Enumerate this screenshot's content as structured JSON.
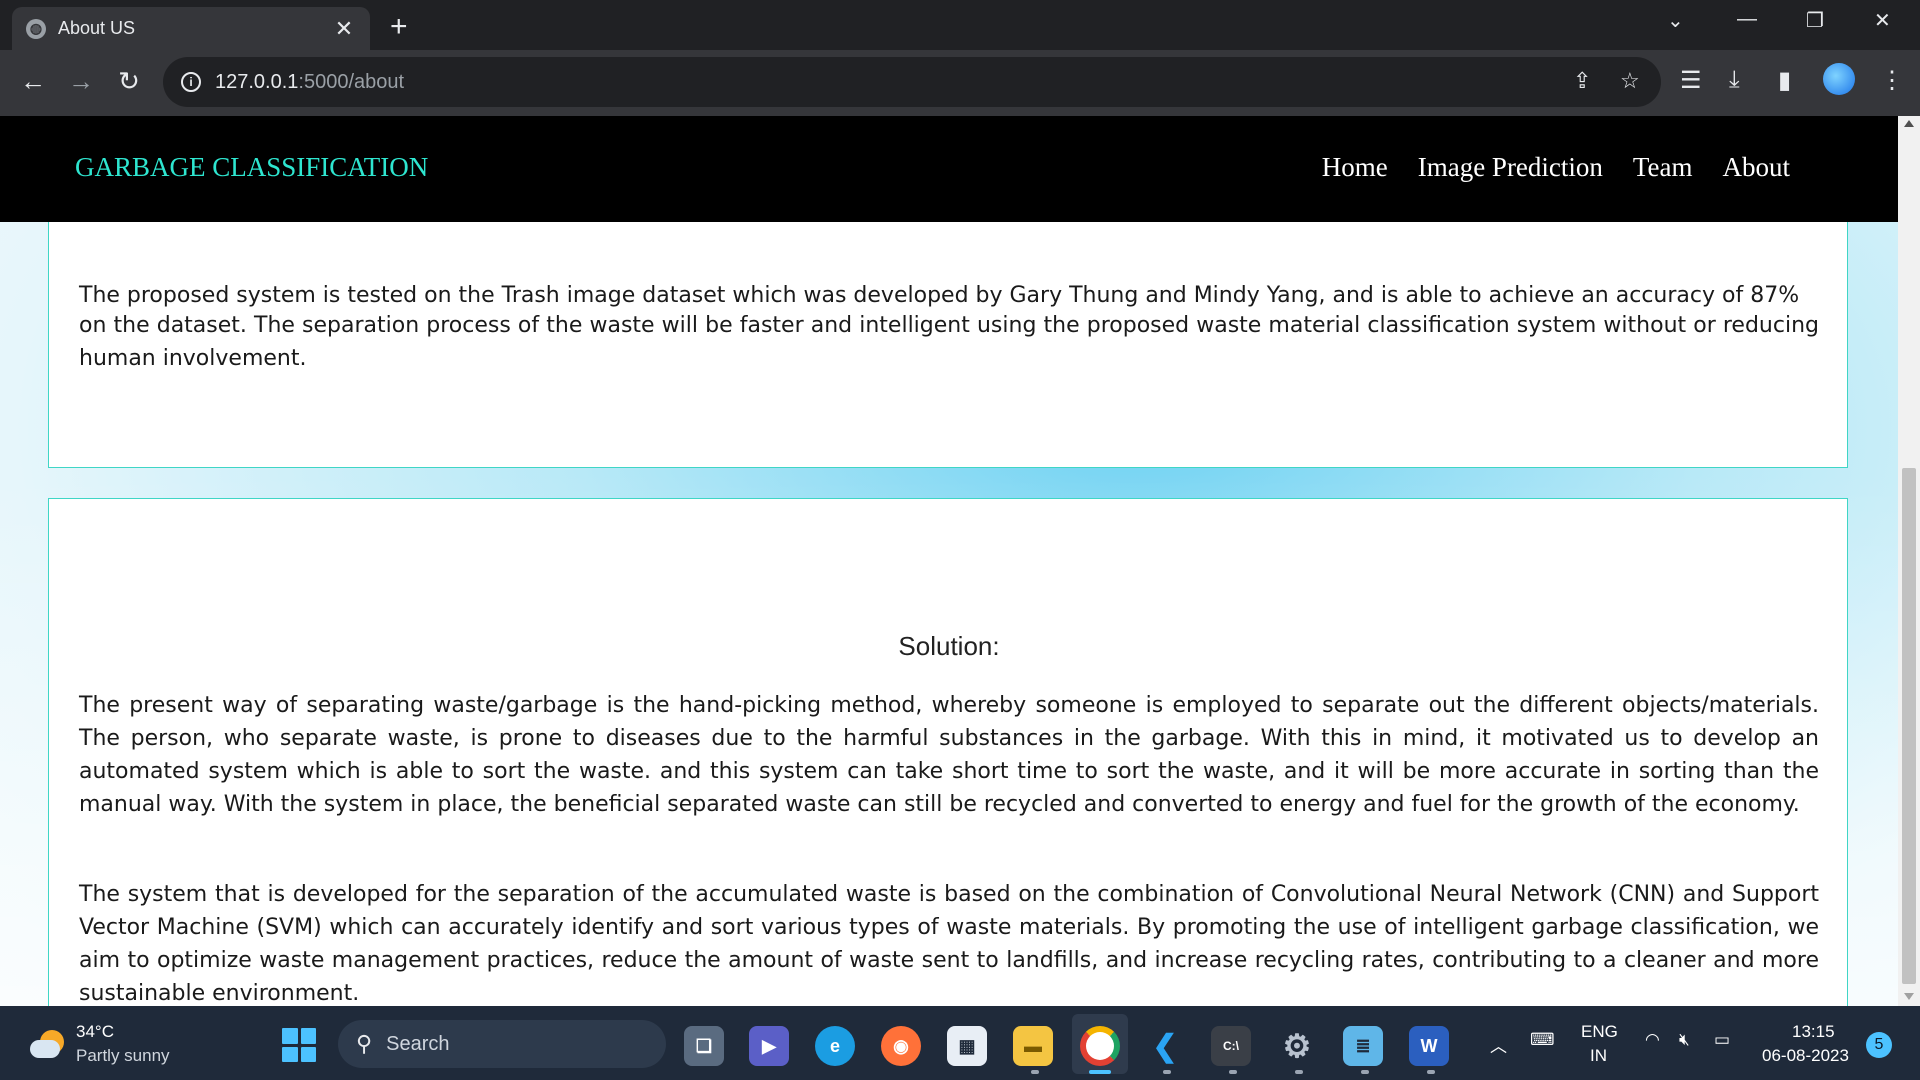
{
  "browser": {
    "tab_title": "About US",
    "url_host": "127.0.0.1",
    "url_path": ":5000/about"
  },
  "site": {
    "brand": "GARBAGE CLASSIFICATION",
    "nav": [
      "Home",
      "Image Prediction",
      "Team",
      "About"
    ],
    "brand_color": "#2ee6d0"
  },
  "content": {
    "card1_partial_line": "The proposed system is tested on the Trash image dataset which was developed by Gary Thung and Mindy Yang, and is able to achieve an accuracy of 87%",
    "card1_text": "on the dataset. The separation process of the waste will be faster and intelligent using the proposed waste material classification system without or reducing human involvement.",
    "solution_heading": "Solution:",
    "solution_p1": "The present way of separating waste/garbage is the hand-picking method, whereby someone is employed to separate out the different objects/materials. The person, who separate waste, is prone to diseases due to the harmful substances in the garbage. With this in mind, it motivated us to develop an automated system which is able to sort the waste. and this system can take short time to sort the waste, and it will be more accurate in sorting than the manual way. With the system in place, the beneficial separated waste can still be recycled and converted to energy and fuel for the growth of the economy.",
    "solution_p2": "The system that is developed for the separation of the accumulated waste is based on the combination of Convolutional Neural Network (CNN) and Support Vector Machine (SVM) which can accurately identify and sort various types of waste materials. By promoting the use of intelligent garbage classification, we aim to optimize waste management practices, reduce the amount of waste sent to landfills, and increase recycling rates, contributing to a cleaner and more sustainable environment."
  },
  "taskbar": {
    "weather_temp": "34°C",
    "weather_desc": "Partly sunny",
    "search_label": "Search",
    "lang_1": "ENG",
    "lang_2": "IN",
    "time": "13:15",
    "date": "06-08-2023",
    "notification_count": "5"
  }
}
